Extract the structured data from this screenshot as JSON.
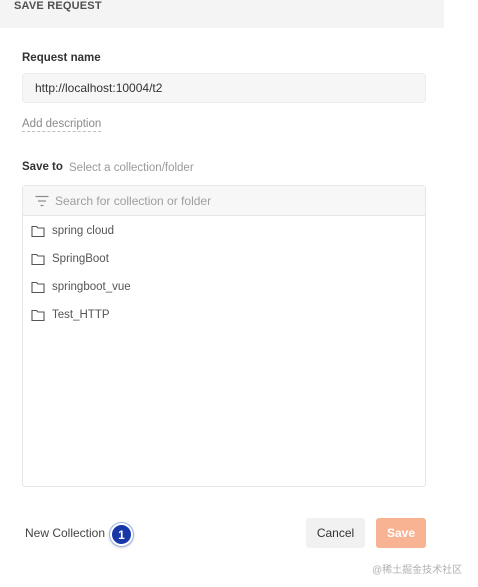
{
  "header": {
    "title": "SAVE REQUEST"
  },
  "request_name": {
    "label": "Request name",
    "value": "http://localhost:10004/t2"
  },
  "add_description": "Add description",
  "save_to": {
    "label": "Save to",
    "hint": "Select a collection/folder"
  },
  "search": {
    "placeholder": "Search for collection or folder",
    "icon": "filter-icon"
  },
  "collections": [
    {
      "label": "spring cloud",
      "icon": "folder-icon"
    },
    {
      "label": "SpringBoot",
      "icon": "folder-icon"
    },
    {
      "label": "springboot_vue",
      "icon": "folder-icon"
    },
    {
      "label": "Test_HTTP",
      "icon": "folder-icon"
    }
  ],
  "footer": {
    "new_collection": "New Collection",
    "badge": "1",
    "cancel": "Cancel",
    "save": "Save"
  },
  "watermark": "@稀土掘金技术社区",
  "colors": {
    "save_button": "#f8b392",
    "badge": "#1736a8",
    "header_bg": "#f4f4f4"
  }
}
